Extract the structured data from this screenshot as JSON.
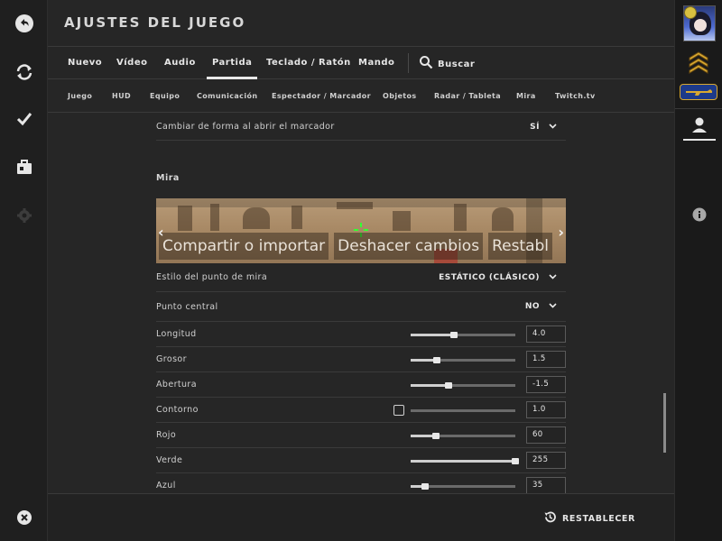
{
  "header": {
    "title": "AJUSTES DEL JUEGO"
  },
  "primary_tabs": [
    {
      "label": "Nuevo"
    },
    {
      "label": "Vídeo"
    },
    {
      "label": "Audio"
    },
    {
      "label": "Partida"
    },
    {
      "label": "Teclado / Ratón"
    },
    {
      "label": "Mando"
    }
  ],
  "active_primary_tab": "Partida",
  "search": {
    "label": "Buscar",
    "icon": "search-icon"
  },
  "sub_tabs": [
    {
      "label": "Juego"
    },
    {
      "label": "HUD"
    },
    {
      "label": "Equipo"
    },
    {
      "label": "Comunicación"
    },
    {
      "label": "Espectador / Marcador"
    },
    {
      "label": "Objetos"
    },
    {
      "label": "Radar / Tableta"
    },
    {
      "label": "Mira"
    },
    {
      "label": "Twitch.tv"
    }
  ],
  "settings": {
    "scoreboard_row": {
      "label": "Cambiar de forma al abrir el marcador",
      "value": "SÍ"
    },
    "crosshair_section_title": "Mira",
    "preview": {
      "buttons": [
        "Compartir o importar",
        "Deshacer cambios",
        "Restabl"
      ]
    },
    "style_row": {
      "label": "Estilo del punto de mira",
      "value": "ESTÁTICO (CLÁSICO)"
    },
    "center_dot_row": {
      "label": "Punto central",
      "value": "NO"
    },
    "sliders": [
      {
        "label": "Longitud",
        "value": "4.0",
        "fraction": 0.41
      },
      {
        "label": "Grosor",
        "value": "1.5",
        "fraction": 0.25
      },
      {
        "label": "Abertura",
        "value": "-1.5",
        "fraction": 0.36
      },
      {
        "label": "Contorno",
        "value": "1.0",
        "fraction": 0.0,
        "checkbox": false
      },
      {
        "label": "Rojo",
        "value": "60",
        "fraction": 0.24
      },
      {
        "label": "Verde",
        "value": "255",
        "fraction": 1.0
      },
      {
        "label": "Azul",
        "value": "35",
        "fraction": 0.14
      }
    ]
  },
  "footer": {
    "reset_label": "RESTABLECER"
  },
  "colors": {
    "background": "#262626",
    "crosshair": "#33ff33",
    "text": "#dcdcdc"
  }
}
